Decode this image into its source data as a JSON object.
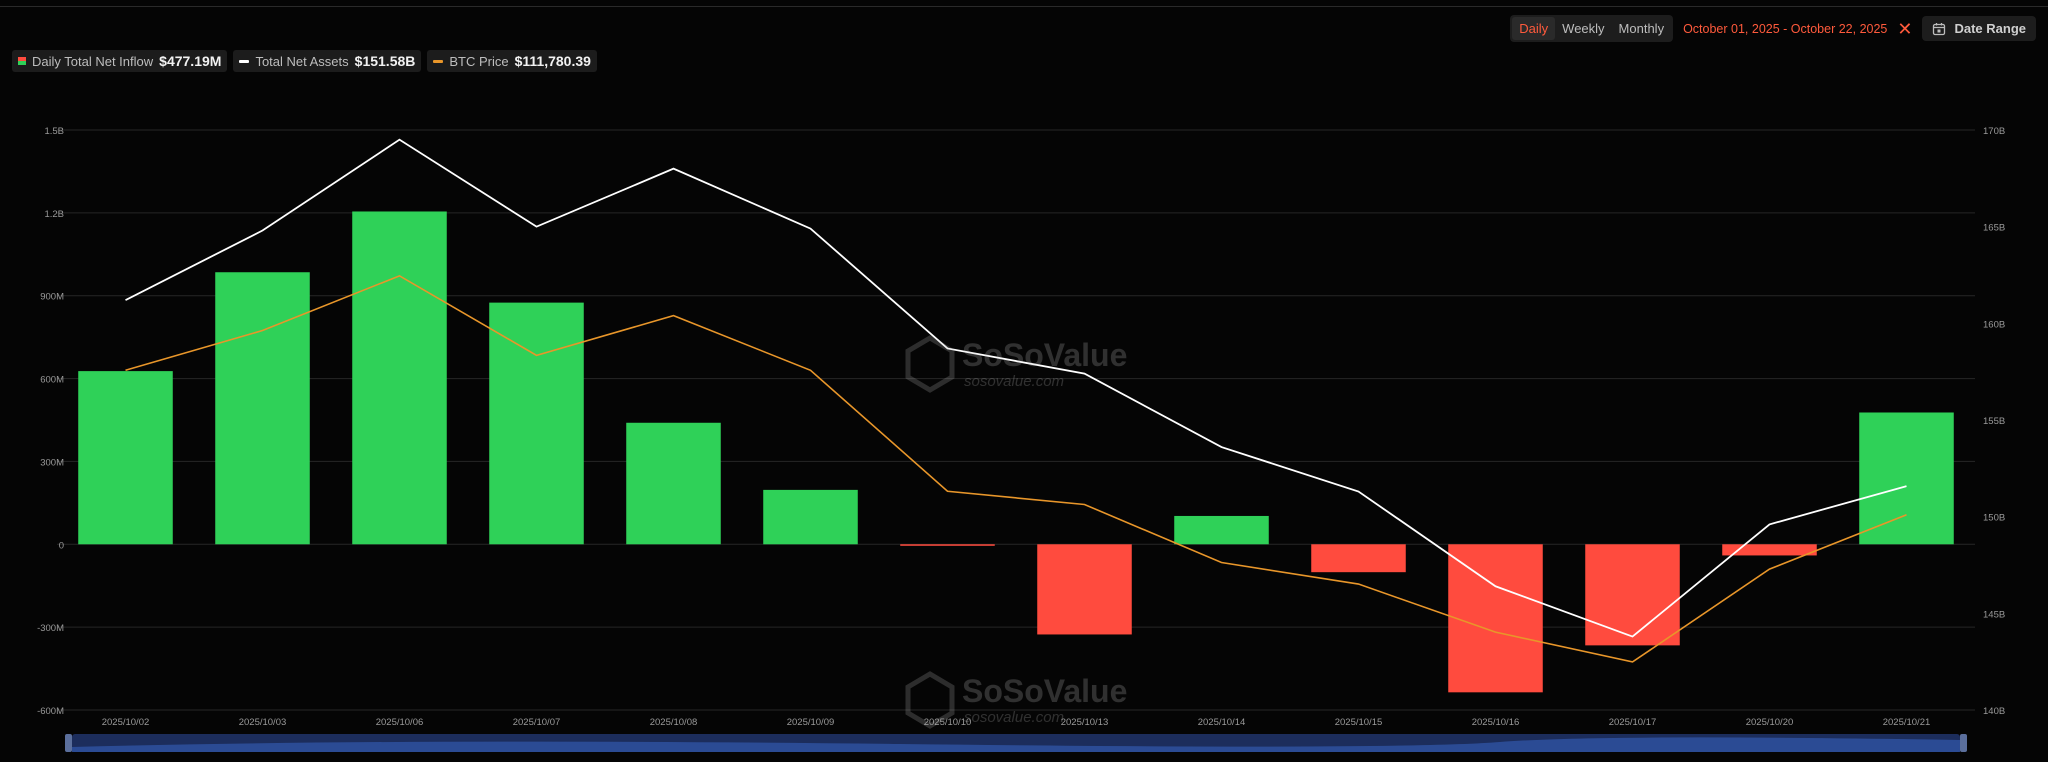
{
  "legend": {
    "inflow": {
      "label": "Daily Total Net Inflow",
      "value": "$477.19M",
      "icon": "bar-swatch-icon"
    },
    "assets": {
      "label": "Total Net Assets",
      "value": "$151.58B",
      "color": "#ffffff"
    },
    "btc": {
      "label": "BTC Price",
      "value": "$111,780.39",
      "color": "#e8962a"
    }
  },
  "toolbar": {
    "periods": [
      "Daily",
      "Weekly",
      "Monthly"
    ],
    "active_period": "Daily",
    "range": "October 01, 2025 - October 22, 2025",
    "close_icon": "close-icon",
    "date_range_label": "Date Range",
    "calendar_icon": "calendar-icon"
  },
  "watermark": {
    "brand": "SoSoValue",
    "site": "sosovalue.com"
  },
  "colors": {
    "positive": "#2fd158",
    "negative": "#ff4b3e",
    "assets_line": "#ffffff",
    "btc_line": "#e8962a",
    "accent": "#ff5a3c"
  },
  "chart_data": {
    "type": "bar",
    "categories": [
      "2025/10/02",
      "2025/10/03",
      "2025/10/06",
      "2025/10/07",
      "2025/10/08",
      "2025/10/09",
      "2025/10/10",
      "2025/10/13",
      "2025/10/14",
      "2025/10/15",
      "2025/10/16",
      "2025/10/17",
      "2025/10/20",
      "2025/10/21"
    ],
    "series": [
      {
        "name": "Daily Total Net Inflow",
        "axis": "left",
        "values": [
          627000000,
          985000000,
          1205000000,
          875000000,
          440000000,
          197000000,
          -4500000,
          -326500000,
          102600000,
          -101000000,
          -536000000,
          -366000000,
          -40400000,
          477190000
        ]
      },
      {
        "name": "Total Net Assets",
        "axis": "right",
        "type": "line",
        "values": [
          161200000000,
          164800000000,
          169500000000,
          165000000000,
          168000000000,
          164900000000,
          158700000000,
          157400000000,
          153600000000,
          151300000000,
          146400000000,
          143800000000,
          149600000000,
          151580000000
        ]
      },
      {
        "name": "BTC Price",
        "axis": "right-hidden",
        "type": "line",
        "values": [
          120500,
          122900,
          126200,
          121400,
          123800,
          120500,
          113200,
          112400,
          108900,
          107600,
          104700,
          102900,
          108500,
          111780.39
        ]
      }
    ],
    "left_axis": {
      "ticks": [
        "1.5B",
        "1.2B",
        "900M",
        "600M",
        "300M",
        "0",
        "-300M",
        "-600M"
      ],
      "range": [
        -600000000,
        1500000000
      ]
    },
    "right_axis": {
      "ticks": [
        "170B",
        "165B",
        "160B",
        "155B",
        "150B",
        "145B",
        "140B"
      ],
      "range": [
        140000000000,
        170000000000
      ]
    },
    "btc_range": [
      100000,
      135000
    ],
    "grid": true,
    "legend_position": "top-left"
  }
}
